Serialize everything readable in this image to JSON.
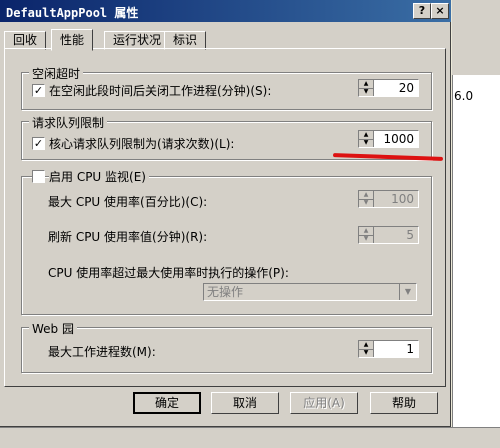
{
  "window": {
    "title": "DefaultAppPool 属性",
    "help_glyph": "?",
    "close_glyph": "×"
  },
  "tabs": [
    {
      "label": "回收"
    },
    {
      "label": "性能"
    },
    {
      "label": "运行状况"
    },
    {
      "label": "标识"
    }
  ],
  "idle_timeout": {
    "legend": "空闲超时",
    "checkbox_label": "在空闲此段时间后关闭工作进程(分钟)(S):",
    "checked": true,
    "value": "20"
  },
  "request_queue": {
    "legend": "请求队列限制",
    "checkbox_label": "核心请求队列限制为(请求次数)(L):",
    "checked": true,
    "value": "1000"
  },
  "cpu_monitor": {
    "checkbox_label": "启用 CPU 监视(E)",
    "checked": false,
    "max_cpu_label": "最大 CPU 使用率(百分比)(C):",
    "max_cpu_value": "100",
    "refresh_label": "刷新 CPU 使用率值(分钟)(R):",
    "refresh_value": "5",
    "action_label": "CPU 使用率超过最大使用率时执行的操作(P):",
    "action_value": "无操作"
  },
  "web_garden": {
    "legend": "Web 园",
    "max_processes_label": "最大工作进程数(M):",
    "max_processes_value": "1"
  },
  "buttons": {
    "ok": "确定",
    "cancel": "取消",
    "apply": "应用(A)",
    "help": "帮助"
  },
  "background": {
    "text": "6.0"
  },
  "colors": {
    "annotation_underline": "#dd1111",
    "title_bar": "#0a246a"
  }
}
